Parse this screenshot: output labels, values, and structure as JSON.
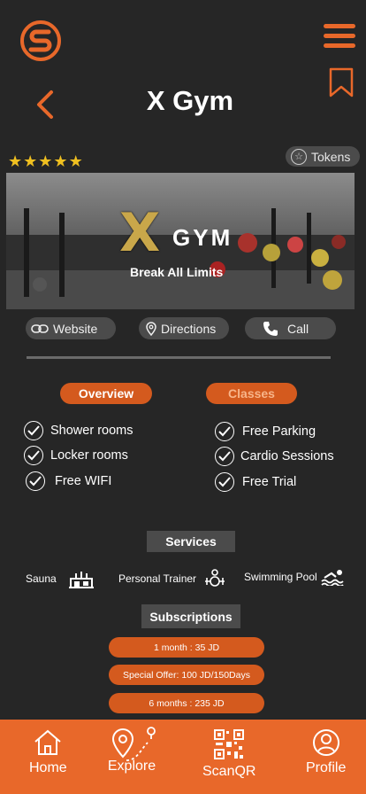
{
  "header": {
    "title": "X Gym",
    "logo_icon": "brand-s-logo",
    "menu_icon": "hamburger-menu-icon",
    "bookmark_icon": "bookmark-icon",
    "back_icon": "back-chevron-icon",
    "accent_color": "#e8682a"
  },
  "rating": {
    "stars": 5,
    "out_of": 5
  },
  "tokens_button": {
    "label": "Tokens",
    "icon": "star-coin-icon"
  },
  "hero": {
    "logo_mark": "X",
    "logo_text": "GYM",
    "tagline": "Break All Limits"
  },
  "actions": {
    "website": "Website",
    "directions": "Directions",
    "call": "Call"
  },
  "tabs": {
    "overview": "Overview",
    "classes": "Classes"
  },
  "amenities": {
    "left": [
      "Shower rooms",
      "Locker rooms",
      "Free WIFI"
    ],
    "right": [
      "Free Parking",
      "Cardio Sessions",
      "Free Trial"
    ]
  },
  "services": {
    "label": "Services",
    "items": [
      {
        "label": "Sauna",
        "icon": "sauna-icon"
      },
      {
        "label": "Personal Trainer",
        "icon": "trainer-icon"
      },
      {
        "label": "Swimming Pool",
        "icon": "swimmer-icon"
      }
    ]
  },
  "subscriptions": {
    "label": "Subscriptions",
    "plans": [
      "1 month : 35 JD",
      "Special Offer: 100 JD/150Days",
      "6 months : 235 JD"
    ]
  },
  "nav": {
    "home": "Home",
    "explore": "Explore",
    "scan": "ScanQR",
    "profile": "Profile"
  }
}
